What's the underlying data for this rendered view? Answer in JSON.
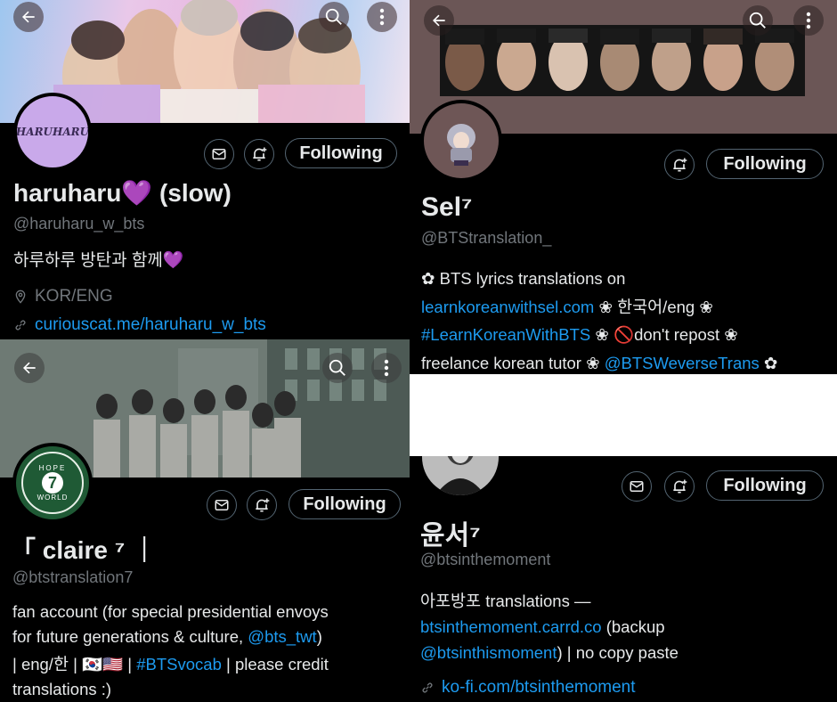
{
  "colors": {
    "accent": "#1d9bf0",
    "muted": "#71767b",
    "text": "#e7e9ea",
    "border": "#536471",
    "heart": "#b084e6"
  },
  "p1": {
    "avatar_text": "HARUHARU",
    "follow_label": "Following",
    "name": "haruharu💜 (slow)",
    "handle": "@haruharu_w_bts",
    "bio": "하루하루 방탄과 함께💜",
    "location": "KOR/ENG",
    "url": "curiouscat.me/haruharu_w_bts"
  },
  "p2": {
    "follow_label": "Following",
    "name": "Sel⁷",
    "handle": "@BTStranslation_",
    "bio_line1": "✿ BTS lyrics translations on",
    "bio_link1": "learnkoreanwithsel.com",
    "bio_line2_rest": " ❀ 한국어/eng ❀",
    "bio_link2": "#LearnKoreanWithBTS",
    "bio_line3_rest": " ❀ 🚫don't repost ❀",
    "bio_line4": "freelance korean tutor ❀ ",
    "bio_link3": "@BTSWeverseTrans",
    "bio_line4_end": " ✿"
  },
  "p3": {
    "avatar_lines": [
      "HOPE",
      "7",
      "WORLD"
    ],
    "follow_label": "Following",
    "name": "「 claire ⁷ ｜",
    "handle": "@btstranslation7",
    "bio_line1": "fan account (for special presidential envoys",
    "bio_line2": "for future generations & culture, ",
    "bio_link1": "@bts_twt",
    "bio_line2_end": ")",
    "bio_line3": "| eng/한 | 🇰🇷🇺🇸 | ",
    "bio_link2": "#BTSvocab",
    "bio_line3_end": " | please credit",
    "bio_line4": "translations :)"
  },
  "p4": {
    "follow_label": "Following",
    "name": "윤서⁷",
    "handle": "@btsinthemoment",
    "bio_line1": "아포방포 translations —",
    "bio_link1": "btsinthemoment.carrd.co",
    "bio_line2_end": " (backup",
    "bio_link2": "@btsinthismoment",
    "bio_line3_end": ") | no copy paste",
    "url": "ko-fi.com/btsinthemoment"
  }
}
